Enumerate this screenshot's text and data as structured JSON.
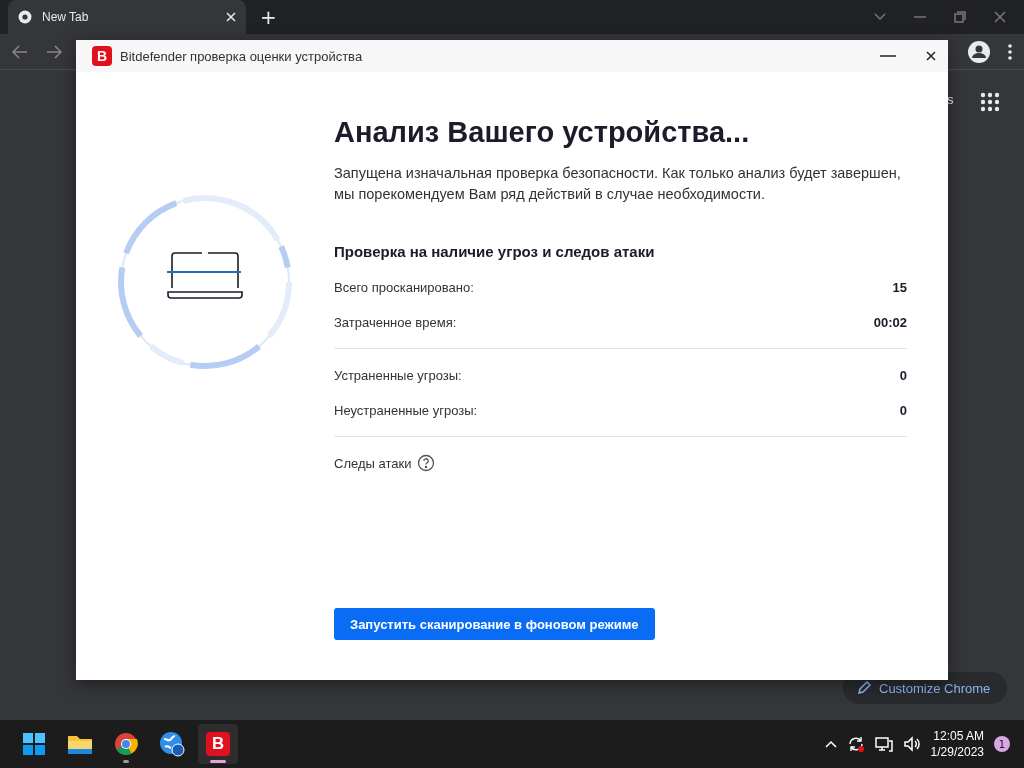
{
  "browser": {
    "tab": {
      "title": "New Tab"
    },
    "new_tab_button": "+",
    "page_link": "s",
    "customize_button": "Customize Chrome"
  },
  "dialog": {
    "logo": "B",
    "title": "Bitdefender проверка оценки устройства",
    "heading": "Анализ Вашего устройства...",
    "description": "Запущена изначальная проверка безопасности. Как только анализ будет завершен, мы порекомендуем Вам ряд действий в случае необходимости.",
    "section_title": "Проверка на наличие угроз и следов атаки",
    "stat_groups": [
      [
        {
          "label": "Всего просканировано:",
          "value": "15"
        },
        {
          "label": "Затраченное время:",
          "value": "00:02"
        }
      ],
      [
        {
          "label": "Устраненные угрозы:",
          "value": "0"
        },
        {
          "label": "Неустраненные угрозы:",
          "value": "0"
        }
      ]
    ],
    "traces_label": "Следы атаки",
    "button": "Запустить сканирование в фоновом режиме"
  },
  "taskbar": {
    "apps": [
      {
        "kind": "start",
        "running": false,
        "selected": false
      },
      {
        "kind": "files",
        "running": false,
        "selected": false
      },
      {
        "kind": "chrome",
        "running": true,
        "selected": false
      },
      {
        "kind": "globe",
        "running": false,
        "selected": false
      },
      {
        "kind": "bitdefender",
        "label": "B",
        "running": true,
        "selected": true
      }
    ],
    "time": "12:05 AM",
    "date": "1/29/2023",
    "notifications": "1"
  }
}
